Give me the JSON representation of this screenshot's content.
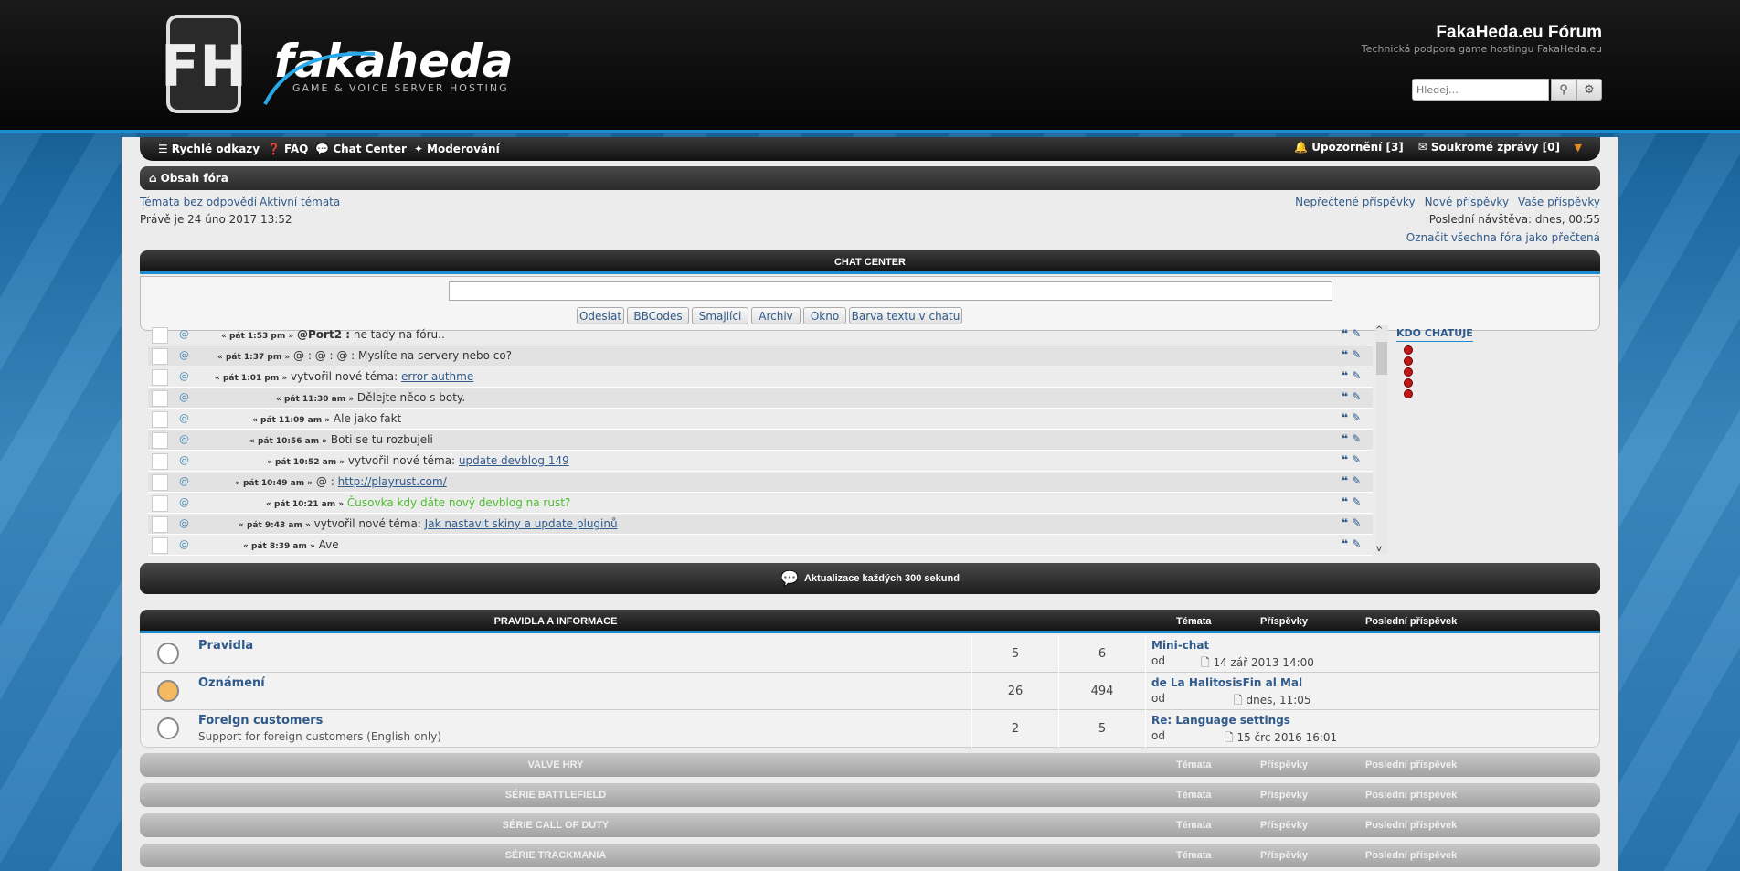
{
  "header": {
    "site_title": "FakaHeda.eu Fórum",
    "site_desc": "Technická podpora game hostingu FakaHeda.eu",
    "logo_text": "fakaheda",
    "logo_sub": "GAME & VOICE SERVER HOSTING",
    "search_placeholder": "Hledej…"
  },
  "nav": {
    "quick_links": "Rychlé odkazy",
    "faq": "FAQ",
    "chat_center": "Chat Center",
    "moderation": "Moderování",
    "notifications": "Upozornění",
    "notifications_count": "[3]",
    "private_messages": "Soukromé zprávy",
    "pm_count": "[0]"
  },
  "breadcrumb": "Obsah fóra",
  "links": {
    "unanswered": "Témata bez odpovědí",
    "active": "Aktivní témata",
    "unread": "Nepřečtené příspěvky",
    "new_posts": "Nové příspěvky",
    "your_posts": "Vaše příspěvky",
    "mark_read": "Označit všechna fóra jako přečtená"
  },
  "status": {
    "now": "Právě je 24 úno 2017 13:52",
    "last_visit": "Poslední návštěva: dnes, 00:55"
  },
  "chat": {
    "title": "CHAT CENTER",
    "buttons": [
      "Odeslat",
      "BBCodes",
      "Smajlíci",
      "Archiv",
      "Okno",
      "Barva textu v chatu"
    ],
    "messages": [
      {
        "at": "@",
        "time": "« pát 1:53 pm »",
        "pre": "@Port2 :",
        "text": " ne tady na fóru..",
        "link": ""
      },
      {
        "at": "@",
        "time": "« pát 1:37 pm »",
        "pre": "@                    : @                    : @",
        "text": "                              :  Myslíte na servery nebo co?",
        "link": ""
      },
      {
        "at": "@",
        "time": "« pát 1:01 pm »",
        "pre": "",
        "text": "vytvořil nové téma: ",
        "link": "error authme"
      },
      {
        "at": "@",
        "time": "« pát 11:30 am »",
        "pre": "",
        "text": "Dělejte něco s boty.",
        "link": ""
      },
      {
        "at": "@",
        "time": "« pát 11:09 am »",
        "pre": "",
        "text": "Ale jako fakt",
        "link": ""
      },
      {
        "at": "@",
        "time": "« pát 10:56 am »",
        "pre": "",
        "text": "Boti se tu rozbujeli",
        "link": ""
      },
      {
        "at": "@",
        "time": "« pát 10:52 am »",
        "pre": "",
        "text": "vytvořil nové téma: ",
        "link": "update devblog 149"
      },
      {
        "at": "@",
        "time": "« pát 10:49 am »",
        "pre": "@                    :",
        "text": "  ",
        "link": "http://playrust.com/"
      },
      {
        "at": "@",
        "time": "« pát 10:21 am »",
        "pre": "",
        "text": "Čusovka kdy dáte nový devblog na rust?",
        "link": ""
      },
      {
        "at": "@",
        "time": "« pát 9:43 am »",
        "pre": "",
        "text": "vytvořil nové téma: ",
        "link": "Jak nastavit skiny a update pluginů"
      },
      {
        "at": "@",
        "time": "« pát 8:39 am »",
        "pre": "",
        "text": "Ave",
        "link": ""
      }
    ],
    "who_title": "KDO CHATUJE",
    "refresh": "Aktualizace každých 300 sekund"
  },
  "forums": {
    "categories": [
      {
        "title": "PRAVIDLA A INFORMACE",
        "topics": "Témata",
        "posts": "Příspěvky",
        "last": "Poslední příspěvek"
      },
      {
        "title": "VALVE HRY",
        "topics": "Témata",
        "posts": "Příspěvky",
        "last": "Poslední příspěvek"
      },
      {
        "title": "SÉRIE BATTLEFIELD",
        "topics": "Témata",
        "posts": "Příspěvky",
        "last": "Poslední příspěvek"
      },
      {
        "title": "SÉRIE CALL OF DUTY",
        "topics": "Témata",
        "posts": "Příspěvky",
        "last": "Poslední příspěvek"
      },
      {
        "title": "SÉRIE TRACKMANIA",
        "topics": "Témata",
        "posts": "Příspěvky",
        "last": "Poslední příspěvek"
      }
    ],
    "rows": [
      {
        "name": "Pravidla",
        "desc": "",
        "topics": "5",
        "posts": "6",
        "last_title": "Mini-chat",
        "by": "od",
        "date": "14 zář 2013 14:00"
      },
      {
        "name": "Oznámení",
        "desc": "",
        "topics": "26",
        "posts": "494",
        "last_title": "de La HalitosisFin al Mal",
        "by": "od",
        "date": "dnes, 11:05"
      },
      {
        "name": "Foreign customers",
        "desc": "Support for foreign customers (English only)",
        "topics": "2",
        "posts": "5",
        "last_title": "Re: Language settings",
        "by": "od",
        "date": "15 črc 2016 16:01"
      }
    ]
  }
}
